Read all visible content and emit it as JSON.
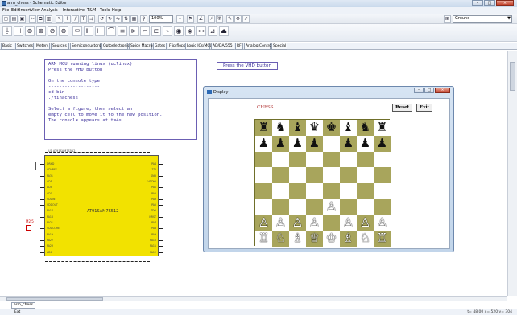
{
  "window": {
    "title": "arm_chess - Schematic Editor"
  },
  "menu": [
    "File",
    "Edit",
    "Insert",
    "View",
    "Analysis",
    "Interactive",
    "T&M",
    "Tools",
    "Help"
  ],
  "toolbar": {
    "zoom": "100%",
    "component_select": "Ground"
  },
  "component_tabs": [
    "Basic",
    "Switches",
    "Meters",
    "Sources",
    "Semiconductors",
    "Optoelectronic",
    "Spice Macros",
    "Gates",
    "Flip flops",
    "Logic ICs/MCUs",
    "AD/DA/555",
    "RF",
    "Analog Control",
    "Special"
  ],
  "note": {
    "lines": [
      "ARM MCU running linux (uclinux)",
      "Press the VHD button",
      "",
      "On the console type",
      "-------------------",
      "cd bin",
      "./tinachess",
      "",
      "Select a figure, then select an",
      "empty cell to move it to the new position.",
      "The console appears at t=4s"
    ]
  },
  "vhd_label": "Press the VHD button",
  "chip": {
    "name": "AT91SAM7S512",
    "marker": "M2 5",
    "top_label": "U1 AT91SAM7S512"
  },
  "chip_pins_left": [
    "DRXD",
    "ADVREF",
    "PA31",
    "AD5",
    "AD4",
    "AD7",
    "VDDIN",
    "VDDOUT",
    "PA17",
    "PA18",
    "PA21",
    "VDDCORE",
    "PA19",
    "PA22",
    "PA23",
    "AD6"
  ],
  "chip_pins_right": [
    "PA4",
    "TDI",
    "GND",
    "VDDIO",
    "PA1",
    "PA2",
    "PA3",
    "PA5",
    "TDO",
    "NRST",
    "PA7",
    "PA8",
    "PA9",
    "PA10",
    "PA11",
    "PA12"
  ],
  "display": {
    "title": "Display",
    "chess_title": "CHESS",
    "reset_label": "Reset",
    "exit_label": "Exit"
  },
  "board": [
    [
      "♜",
      "♞",
      "♝",
      "♛",
      "♚",
      "♝",
      "♞",
      "♜"
    ],
    [
      "♟",
      "♟",
      "♟",
      "♟",
      "",
      "♟",
      "♟",
      "♟"
    ],
    [
      "",
      "",
      "",
      "",
      "",
      "",
      "",
      ""
    ],
    [
      "",
      "",
      "",
      "",
      "",
      "",
      "",
      ""
    ],
    [
      "",
      "",
      "",
      "",
      "",
      "",
      "",
      ""
    ],
    [
      "",
      "",
      "",
      "",
      "♙",
      "",
      "",
      ""
    ],
    [
      "♙",
      "♙",
      "♙",
      "♙",
      "",
      "♙",
      "♙",
      "♙"
    ],
    [
      "♖",
      "♘",
      "♗",
      "♕",
      "♔",
      "♗",
      "♘",
      "♖"
    ]
  ],
  "board_colors": {
    "dark": "#a8a55c",
    "light": "#ffffff"
  },
  "sheet_tab": "arm_chess",
  "status": {
    "left": "Ext",
    "right": "t= 48.00   x= 520 y= 304"
  }
}
